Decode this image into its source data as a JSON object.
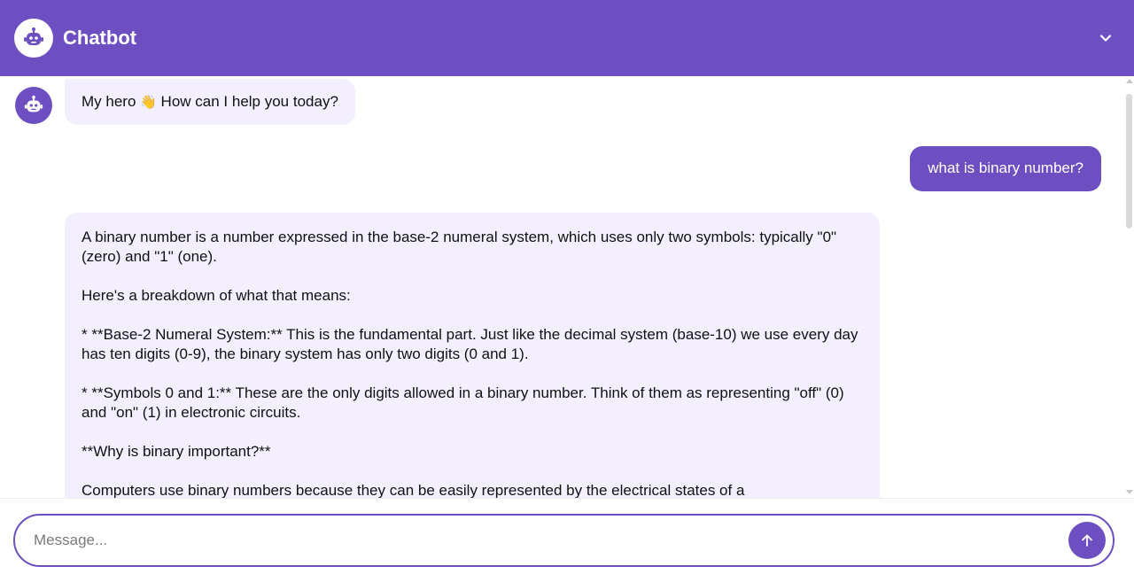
{
  "header": {
    "title": "Chatbot",
    "logo_icon": "robot-icon",
    "collapse_icon": "chevron-down-icon",
    "background": "#6d4fc2"
  },
  "messages": [
    {
      "role": "bot",
      "avatar_icon": "robot-icon",
      "text_before_emoji": "My hero ",
      "emoji": "👋",
      "text_after_emoji": " How can I help you today?"
    },
    {
      "role": "user",
      "text": "what is binary number?"
    },
    {
      "role": "bot",
      "text": "A binary number is a number expressed in the base-2 numeral system, which uses only two symbols: typically \"0\" (zero) and \"1\" (one).\n\nHere's a breakdown of what that means:\n\n* **Base-2 Numeral System:** This is the fundamental part. Just like the decimal system (base-10) we use every day has ten digits (0-9), the binary system has only two digits (0 and 1).\n\n* **Symbols 0 and 1:** These are the only digits allowed in a binary number. Think of them as representing \"off\" (0) and \"on\" (1) in electronic circuits.\n\n**Why is binary important?**\n\nComputers use binary numbers because they can be easily represented by the electrical states of a"
    }
  ],
  "composer": {
    "placeholder": "Message...",
    "value": "",
    "send_icon": "arrow-up-icon"
  },
  "colors": {
    "accent": "#6d4fc2",
    "bot_bubble": "#f3efff",
    "user_bubble": "#6d4fc2"
  }
}
